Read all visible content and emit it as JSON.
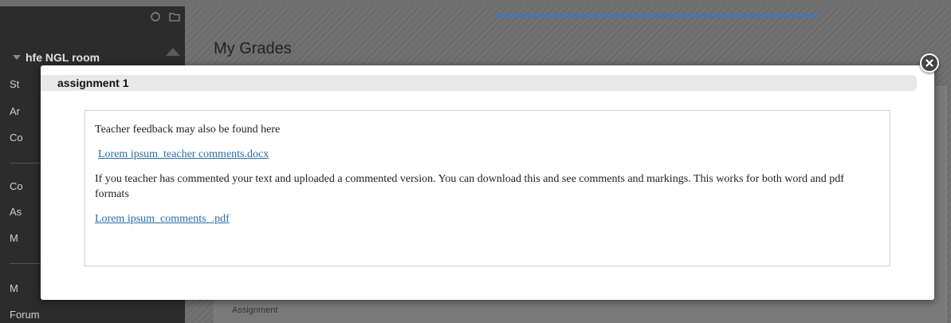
{
  "sidebar": {
    "course_name": "hfe NGL room",
    "items": [
      "St",
      "Ar",
      "Co",
      "Co",
      "As",
      "M",
      "M",
      "Forum"
    ]
  },
  "main": {
    "page_title": "My Grades",
    "table_column": "Assignment"
  },
  "modal": {
    "title": "assignment 1",
    "paragraph_1": "Teacher feedback may also be found here",
    "link_1": "Lorem ipsum_teacher comments.docx",
    "paragraph_2": "If you teacher has commented your text and uploaded a commented version. You can download this and see comments and markings. This works for both word and pdf formats",
    "link_2": "Lorem ipsum_comments_.pdf"
  },
  "colors": {
    "link": "#2a6ea8",
    "progress": "#3f76b4",
    "sidebar_bg": "#2c2c2c"
  }
}
